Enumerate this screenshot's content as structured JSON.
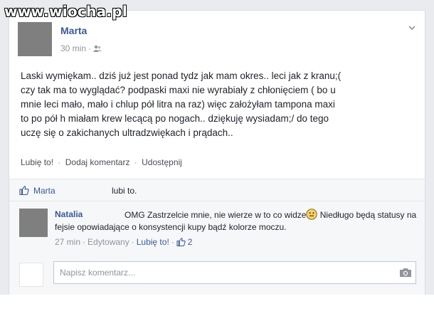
{
  "watermark": "www.wiocha.pl",
  "post": {
    "author": "Marta",
    "time": "30 min",
    "audience_icon": "friends-icon",
    "text_lines": [
      "Laski wymiękam.. dziś już jest ponad tydz jak mam okres.. leci jak z kranu;(",
      "czy tak ma to wyglądać? podpaski maxi nie wyrabiały z chłonięciem ( bo u",
      "mnie leci mało, mało i chlup pół litra na raz) więc założyłam tampona maxi",
      "to po pół h miałam krew lecącą po nogach.. dziękuję wysiadam;/ do tego",
      "uczę się o zakichanych ultradzwiękach i prądach.."
    ],
    "actions": {
      "like": "Lubię to!",
      "comment": "Dodaj komentarz",
      "share": "Udostępnij",
      "separator": "·"
    }
  },
  "likes": {
    "name": "Marta",
    "suffix": "lubi to."
  },
  "comment": {
    "author": "Natalia",
    "text_part1": "OMG Zastrzelcie mnie, nie wierze w to co widze",
    "text_part2": " Niedługo będą statusy na fejsie opowiadające o konsystencji kupy bądź kolorze moczu.",
    "time": "27 min",
    "edited": "Edytowany",
    "like": "Lubię to!",
    "like_count": "2",
    "separator": "·"
  },
  "compose": {
    "placeholder": "Napisz komentarz..."
  },
  "colors": {
    "link": "#3b5998",
    "meta": "#90949c",
    "background": "#e9ebee"
  }
}
